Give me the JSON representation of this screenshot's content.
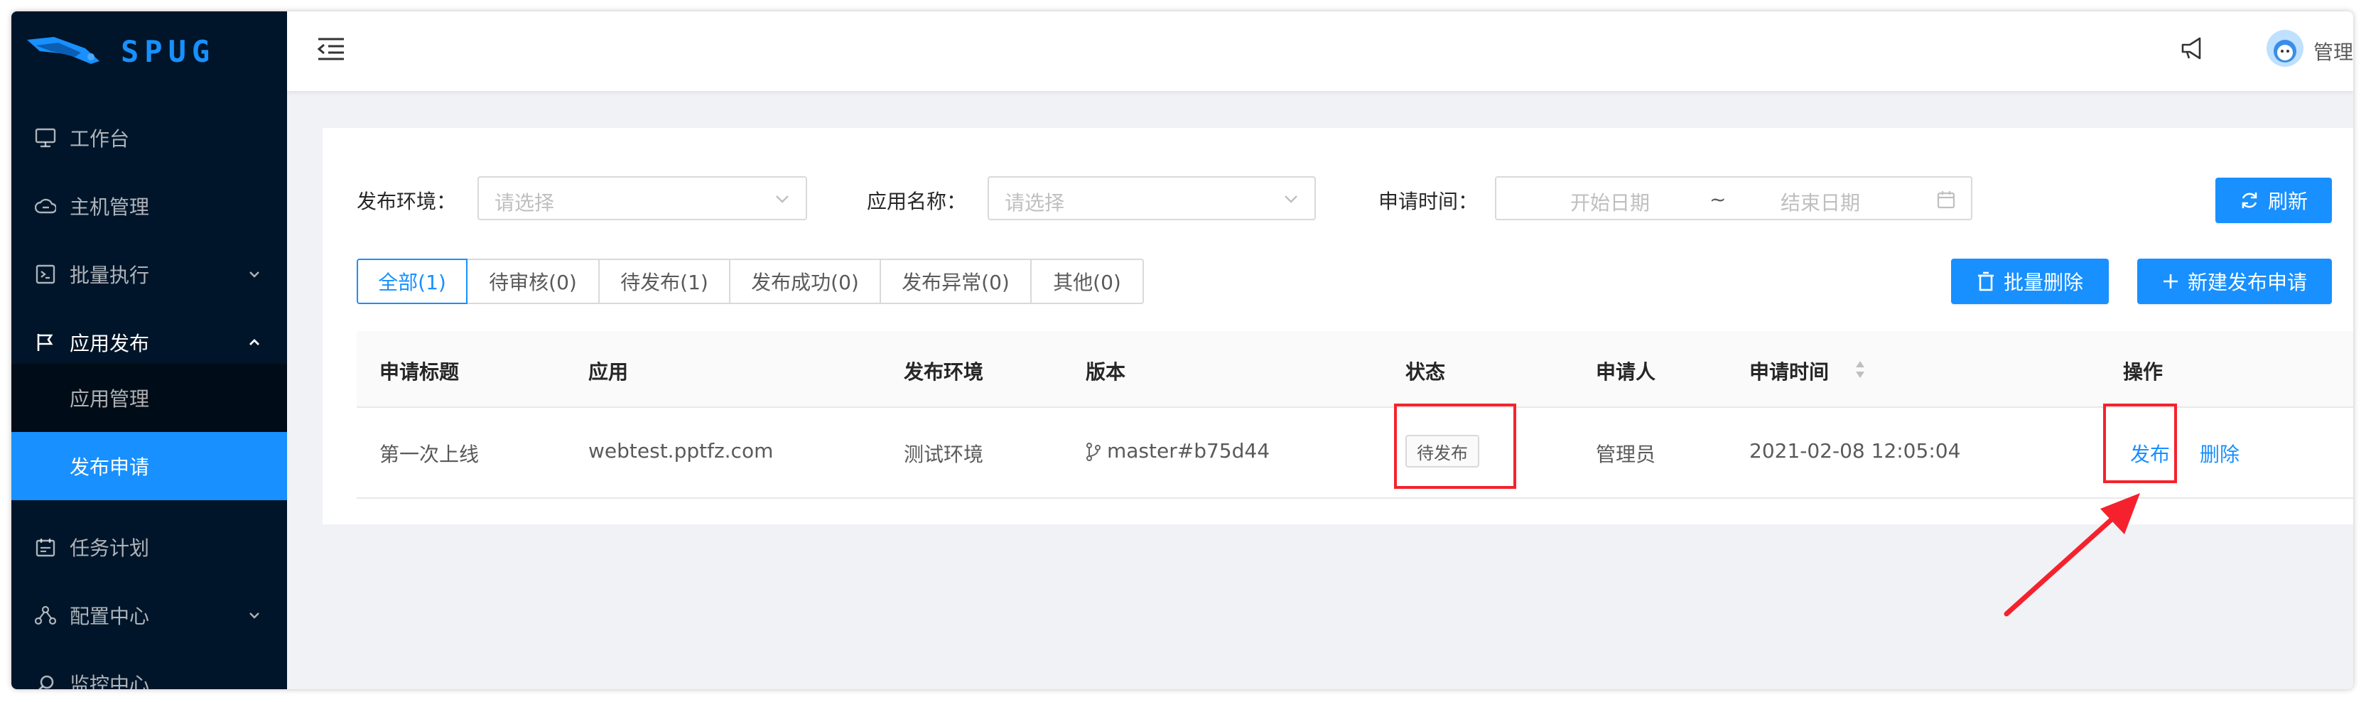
{
  "app": {
    "logo_text": "SPUG"
  },
  "colors": {
    "primary": "#1890ff",
    "sidebar_bg": "#001529",
    "annotation_red": "#f5222d"
  },
  "sidebar": {
    "items": [
      {
        "label": "工作台",
        "icon": "desktop-icon"
      },
      {
        "label": "主机管理",
        "icon": "cloud-server-icon"
      },
      {
        "label": "批量执行",
        "icon": "terminal-icon",
        "expandable": true
      },
      {
        "label": "应用发布",
        "icon": "flag-icon",
        "expandable": true,
        "open": true
      },
      {
        "label": "任务计划",
        "icon": "schedule-icon"
      },
      {
        "label": "配置中心",
        "icon": "cluster-icon",
        "expandable": true
      },
      {
        "label": "监控中心",
        "icon": "monitor-search-icon"
      }
    ],
    "submenu": [
      {
        "label": "应用管理"
      },
      {
        "label": "发布申请",
        "active": true
      }
    ]
  },
  "header": {
    "user_name": "管理员",
    "menu_fold_icon": "menu-fold-icon",
    "notification_icon": "notification-icon"
  },
  "filters": {
    "env_label": "发布环境：",
    "env_placeholder": "请选择",
    "app_label": "应用名称：",
    "app_placeholder": "请选择",
    "time_label": "申请时间：",
    "start_placeholder": "开始日期",
    "range_sep": "~",
    "end_placeholder": "结束日期",
    "refresh_label": "刷新"
  },
  "tabs": [
    {
      "label": "全部(1)",
      "active": true
    },
    {
      "label": "待审核(0)"
    },
    {
      "label": "待发布(1)"
    },
    {
      "label": "发布成功(0)"
    },
    {
      "label": "发布异常(0)"
    },
    {
      "label": "其他(0)"
    }
  ],
  "actions": {
    "batch_delete": "批量删除",
    "new_request": "新建发布申请"
  },
  "table": {
    "columns": [
      "申请标题",
      "应用",
      "发布环境",
      "版本",
      "状态",
      "申请人",
      "申请时间",
      "操作"
    ],
    "rows": [
      {
        "title": "第一次上线",
        "app": "webtest.pptfz.com",
        "env": "测试环境",
        "version": "master#b75d44",
        "status": "待发布",
        "applicant": "管理员",
        "time": "2021-02-08 12:05:04",
        "op_publish": "发布",
        "op_delete": "删除"
      }
    ]
  }
}
